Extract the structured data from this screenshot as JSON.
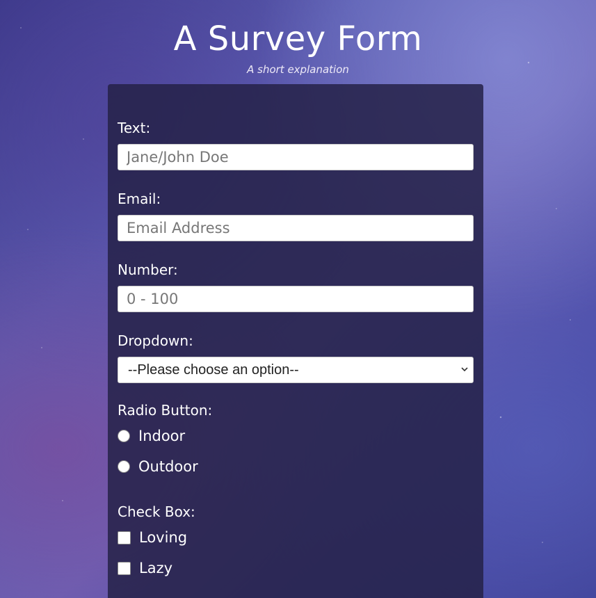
{
  "header": {
    "title": "A Survey Form",
    "subtitle": "A short explanation"
  },
  "form": {
    "text_field": {
      "label": "Text:",
      "placeholder": "Jane/John Doe",
      "value": ""
    },
    "email_field": {
      "label": "Email:",
      "placeholder": "Email Address",
      "value": ""
    },
    "number_field": {
      "label": "Number:",
      "placeholder": "0 - 100",
      "value": ""
    },
    "dropdown": {
      "label": "Dropdown:",
      "selected": "--Please choose an option--",
      "icon": "chevron-down-icon"
    },
    "radio": {
      "label": "Radio Button:",
      "options": [
        {
          "label": "Indoor",
          "checked": false
        },
        {
          "label": "Outdoor",
          "checked": false
        }
      ]
    },
    "checkbox": {
      "label": "Check Box:",
      "options": [
        {
          "label": "Loving",
          "checked": false
        },
        {
          "label": "Lazy",
          "checked": false
        }
      ]
    }
  }
}
